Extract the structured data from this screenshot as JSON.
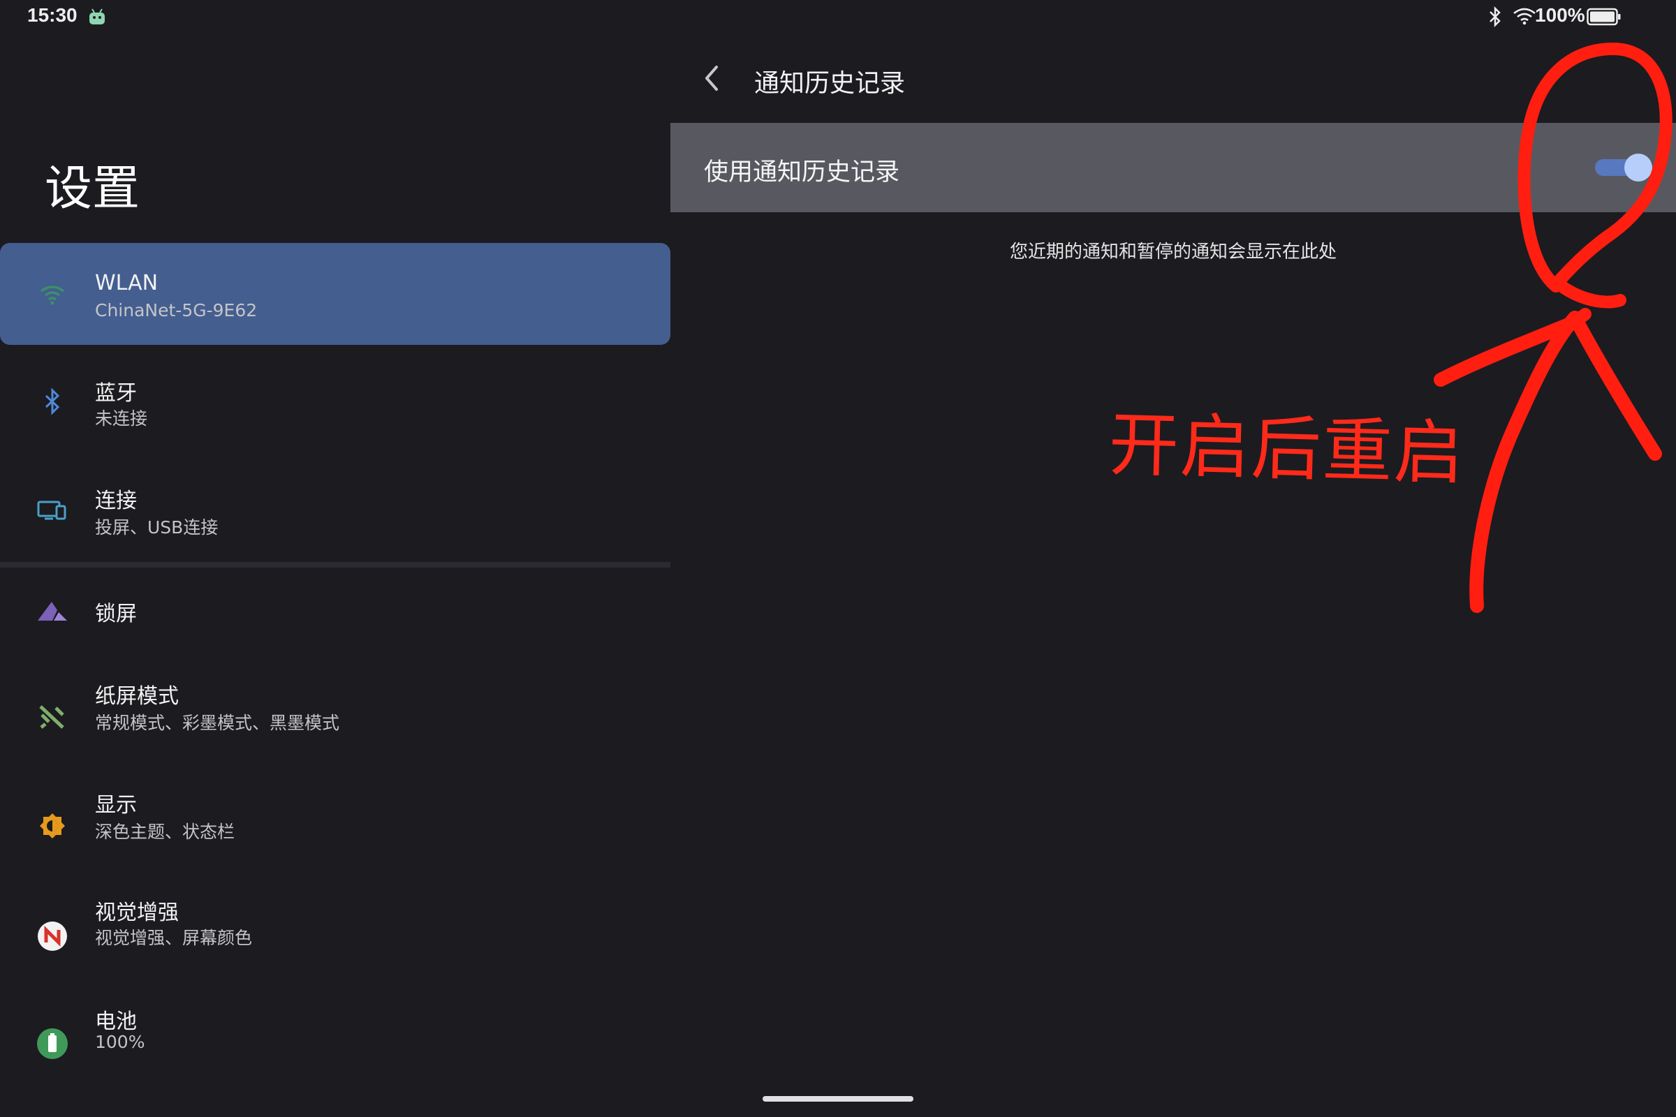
{
  "status_bar": {
    "time": "15:30",
    "battery_text": "100%",
    "icons": [
      "android-robot-icon",
      "bluetooth-icon",
      "wifi-icon",
      "battery-icon"
    ]
  },
  "left": {
    "title": "设置",
    "items": [
      {
        "title": "WLAN",
        "subtitle": "ChinaNet-5G-9E62",
        "icon": "wifi-icon",
        "selected": true
      },
      {
        "title": "蓝牙",
        "subtitle": "未连接",
        "icon": "bluetooth-icon"
      },
      {
        "title": "连接",
        "subtitle": "投屏、USB连接",
        "icon": "connection-devices-icon"
      },
      {
        "title": "锁屏",
        "subtitle": "",
        "icon": "lockscreen-mountain-icon"
      },
      {
        "title": "纸屏模式",
        "subtitle": "常规模式、彩墨模式、黑墨模式",
        "icon": "paper-mode-icon"
      },
      {
        "title": "显示",
        "subtitle": "深色主题、状态栏",
        "icon": "display-brightness-icon"
      },
      {
        "title": "视觉增强",
        "subtitle": "视觉增强、屏幕颜色",
        "icon": "visual-enhance-icon"
      },
      {
        "title": "电池",
        "subtitle": "100%",
        "icon": "battery-icon"
      }
    ]
  },
  "right": {
    "page_title": "通知历史记录",
    "toggle_label": "使用通知历史记录",
    "toggle_on": true,
    "hint": "您近期的通知和暂停的通知会显示在此处"
  },
  "annotation": {
    "text": "开启后重启",
    "color": "#ff2a1a"
  },
  "colors": {
    "background": "#1c1b20",
    "selected_item": "#445e8f",
    "toggle_row": "#585960",
    "switch_track": "#5879c0",
    "switch_thumb": "#b7cdfa"
  }
}
